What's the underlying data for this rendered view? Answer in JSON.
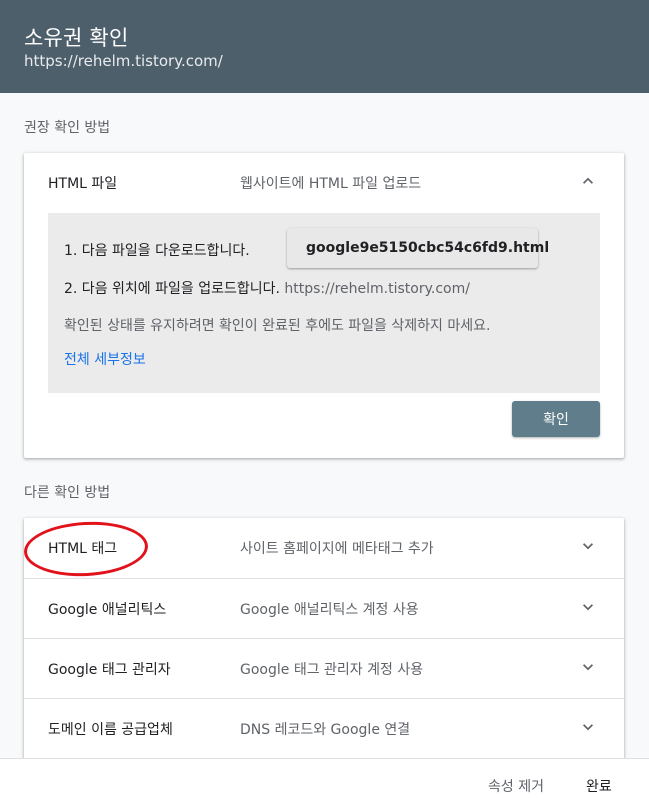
{
  "header": {
    "title": "소유권 확인",
    "url": "https://rehelm.tistory.com/"
  },
  "recommended": {
    "label": "권장 확인 방법",
    "method": {
      "name": "HTML 파일",
      "description": "웹사이트에 HTML 파일 업로드",
      "expanded": true,
      "step1": "1. 다음 파일을 다운로드합니다.",
      "download_file": "google9e5150cbc54c6fd9.html",
      "step2": "2. 다음 위치에 파일을 업로드합니다.",
      "step2_url": "https://rehelm.tistory.com/",
      "note": "확인된 상태를 유지하려면 확인이 완료된 후에도 파일을 삭제하지 마세요.",
      "details_link": "전체 세부정보",
      "confirm_label": "확인"
    }
  },
  "other": {
    "label": "다른 확인 방법",
    "methods": [
      {
        "name": "HTML 태그",
        "description": "사이트 홈페이지에 메타태그 추가"
      },
      {
        "name": "Google 애널리틱스",
        "description": "Google 애널리틱스 계정 사용"
      },
      {
        "name": "Google 태그 관리자",
        "description": "Google 태그 관리자 계정 사용"
      },
      {
        "name": "도메인 이름 공급업체",
        "description": "DNS 레코드와 Google 연결"
      }
    ]
  },
  "footer": {
    "remove_label": "속성 제거",
    "done_label": "완료"
  },
  "colors": {
    "header_bg": "#4d5f6b",
    "primary_button": "#5f7d8b",
    "link": "#1a73e8",
    "annotation": "#e1121a"
  }
}
